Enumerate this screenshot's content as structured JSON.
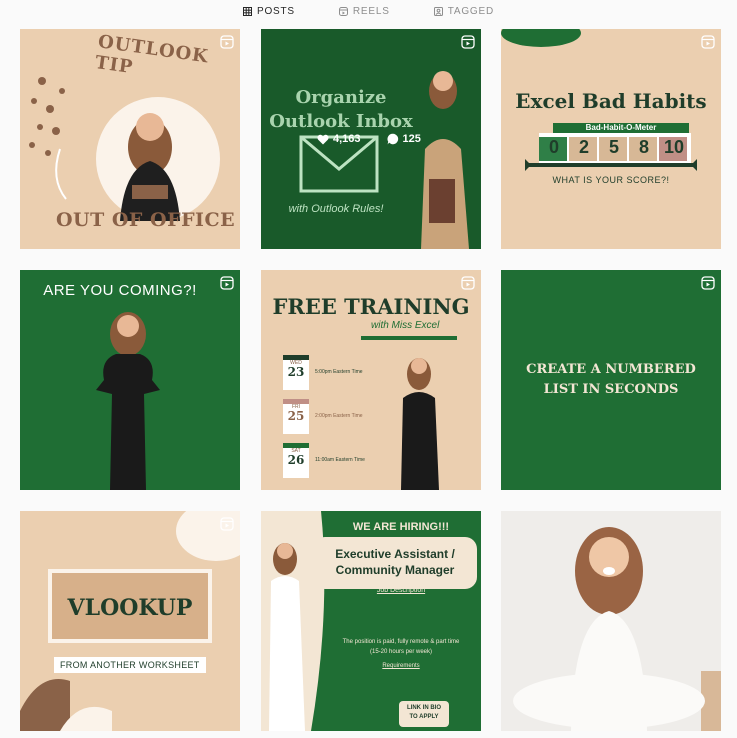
{
  "tabs": [
    {
      "label": "POSTS",
      "icon": "grid-icon",
      "active": true
    },
    {
      "label": "REELS",
      "icon": "reels-icon",
      "active": false
    },
    {
      "label": "TAGGED",
      "icon": "tagged-icon",
      "active": false
    }
  ],
  "posts": {
    "p1": {
      "top": "OUTLOOK TIP",
      "bottom": "OUT OF OFFICE"
    },
    "p2": {
      "line1": "Organize",
      "line2": "Outlook Inbox",
      "script": "with Outlook Rules!",
      "likes": "4,163",
      "comments": "125"
    },
    "p3": {
      "title": "Excel Bad Habits",
      "meter_label": "Bad-Habit-O-Meter",
      "digits": [
        "0",
        "2",
        "5",
        "8",
        "10"
      ],
      "score": "WHAT IS YOUR SCORE?!"
    },
    "p4": {
      "title": "ARE YOU COMING?!"
    },
    "p5": {
      "title": "FREE TRAINING",
      "sub": "with Miss Excel",
      "events": [
        {
          "month": "FEBRUARY",
          "day_name": "WED",
          "day": "23",
          "time": "5:00pm Eastern Time"
        },
        {
          "month": "FEBRUARY",
          "day_name": "FRI",
          "day": "25",
          "time": "2:00pm Eastern Time"
        },
        {
          "month": "FEBRUARY",
          "day_name": "SAT",
          "day": "26",
          "time": "11:00am Eastern Time"
        }
      ]
    },
    "p6": {
      "line1": "CREATE A NUMBERED",
      "line2": "LIST IN SECONDS"
    },
    "p7": {
      "title": "VLOOKUP",
      "sub": "FROM ANOTHER WORKSHEET"
    },
    "p8": {
      "hiring": "WE ARE HIRING!!!",
      "role1": "Executive Assistant /",
      "role2": "Community Manager",
      "jd": "Job Description",
      "detail1": "The position is paid, fully remote & part time",
      "detail2": "(15-20 hours per week)",
      "req": "Requirements",
      "cta1": "LINK IN BIO",
      "cta2": "TO APPLY"
    }
  },
  "colors": {
    "beige": "#ebcfb0",
    "green": "#1f6e34",
    "brown": "#8a6248",
    "dark": "#2a2a2a"
  }
}
